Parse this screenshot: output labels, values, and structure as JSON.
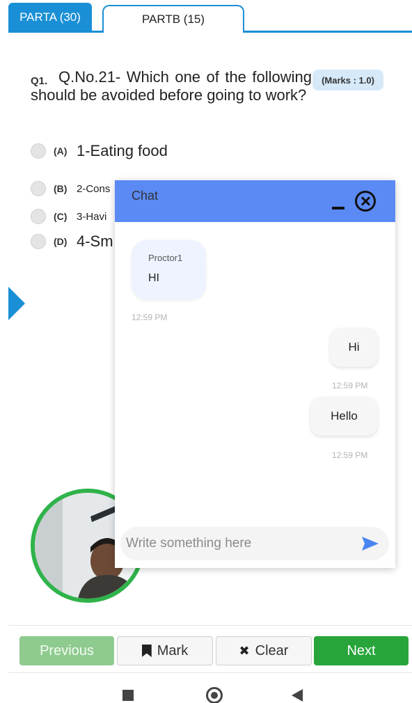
{
  "tabs": [
    {
      "label": "PARTA (30)",
      "active": true
    },
    {
      "label": "PARTB (15)",
      "active": false
    }
  ],
  "question": {
    "number": "Q1.",
    "text": "Q.No.21- Which one of the following should be avoided before going to work?",
    "marks": "(Marks : 1.0)"
  },
  "options": [
    {
      "letter": "(A)",
      "text": "1-Eating food"
    },
    {
      "letter": "(B)",
      "text": "2-Cons"
    },
    {
      "letter": "(C)",
      "text": "3-Havi"
    },
    {
      "letter": "(D)",
      "text": "4-Sm"
    }
  ],
  "chat": {
    "title": "Chat",
    "messages": [
      {
        "sender": "Proctor1",
        "text": "HI",
        "time": "12:59 PM",
        "direction": "incoming"
      },
      {
        "text": "Hi",
        "time": "12:59 PM",
        "direction": "outgoing"
      },
      {
        "text": "Hello",
        "time": "12:59 PM",
        "direction": "outgoing"
      }
    ],
    "input_placeholder": "Write something here"
  },
  "nav": {
    "previous": "Previous",
    "mark": "Mark",
    "clear": "Clear",
    "next": "Next"
  },
  "colors": {
    "accent": "#1a8fd6",
    "chat_header": "#5b8af5",
    "next": "#27a53a",
    "previous_disabled": "#8fcb8f",
    "webcam_border": "#2fb34a"
  },
  "icons": {
    "minimize": "minimize-icon",
    "close": "close-circle-icon",
    "send": "send-icon",
    "mark": "bookmark-icon",
    "clear": "x-icon",
    "side": "triangle-right-icon"
  }
}
